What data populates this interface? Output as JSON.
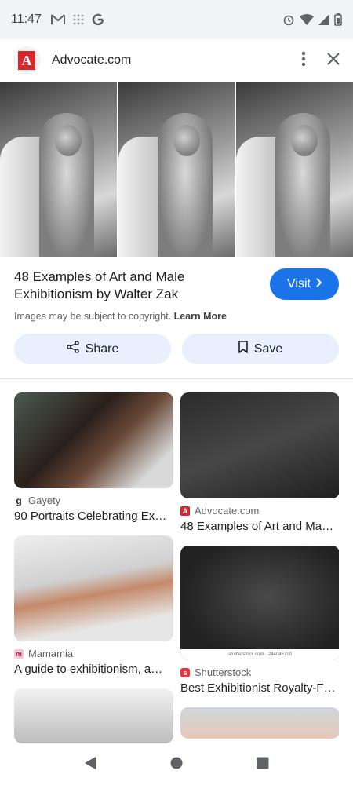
{
  "status_bar": {
    "time": "11:47",
    "left_icons": [
      "gmail-icon",
      "grid-dots-icon",
      "google-icon"
    ],
    "right_icons": [
      "alarm-icon",
      "wifi-icon",
      "signal-icon",
      "battery-icon"
    ]
  },
  "header": {
    "site_logo_letter": "A",
    "site_name": "Advocate.com",
    "more_icon": "more-vert-icon",
    "close_icon": "close-icon"
  },
  "result": {
    "title": "48 Examples of Art and Male Exhibitionism by Walter Zak",
    "visit_label": "Visit",
    "copyright_text": "Images may be subject to copyright.",
    "learn_more": "Learn More"
  },
  "actions": {
    "share_label": "Share",
    "save_label": "Save"
  },
  "related": {
    "left": [
      {
        "source": "Gayety",
        "title": "90 Portraits Celebrating Ex…"
      },
      {
        "source": "Mamamia",
        "title": "A guide to exhibitionism, a…"
      },
      {
        "source": "",
        "title": ""
      }
    ],
    "right": [
      {
        "source": "Advocate.com",
        "title": "48 Examples of Art and Ma…"
      },
      {
        "source": "Shutterstock",
        "title": "Best Exhibitionist Royalty-F…",
        "watermark": "shutterstock.com · 244046710"
      },
      {
        "source": "",
        "title": ""
      }
    ]
  },
  "colors": {
    "accent": "#1a73e8",
    "chip_bg": "#e8f0fe",
    "advocate_red": "#d7262c",
    "shutterstock_red": "#e8323c"
  }
}
